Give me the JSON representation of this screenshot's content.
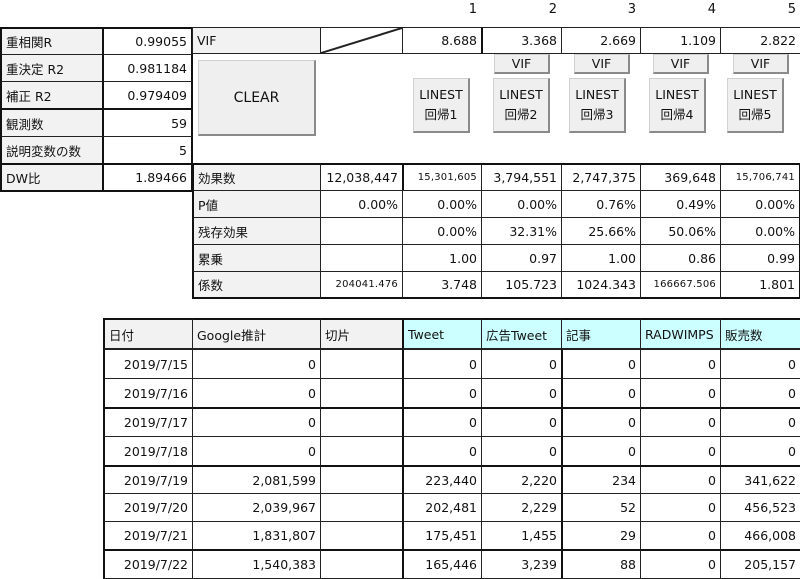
{
  "stats": [
    {
      "label": "重相関R",
      "value": "0.99055"
    },
    {
      "label": "重決定 R2",
      "value": "0.981184"
    },
    {
      "label": "補正 R2",
      "value": "0.979409"
    },
    {
      "label": "観測数",
      "value": "59"
    },
    {
      "label": "説明変数の数",
      "value": "5"
    },
    {
      "label": "DW比",
      "value": "1.89466"
    }
  ],
  "column_numbers": [
    "1",
    "2",
    "3",
    "4",
    "5"
  ],
  "vif_row": {
    "label": "VIF",
    "values": [
      "8.688",
      "3.368",
      "2.669",
      "1.109",
      "2.822"
    ]
  },
  "buttons": {
    "clear": "CLEAR",
    "vif": [
      "VIF",
      "VIF",
      "VIF",
      "VIF"
    ],
    "linest": [
      {
        "line1": "LINEST",
        "line2": "回帰1"
      },
      {
        "line1": "LINEST",
        "line2": "回帰2"
      },
      {
        "line1": "LINEST",
        "line2": "回帰3"
      },
      {
        "line1": "LINEST",
        "line2": "回帰4"
      },
      {
        "line1": "LINEST",
        "line2": "回帰5"
      }
    ]
  },
  "effects": [
    {
      "label": "効果数",
      "values": [
        "12,038,447",
        "15,301,605",
        "3,794,551",
        "2,747,375",
        "369,648",
        "15,706,741"
      ]
    },
    {
      "label": "P値",
      "values": [
        "0.00%",
        "0.00%",
        "0.00%",
        "0.76%",
        "0.49%",
        "0.00%"
      ]
    },
    {
      "label": "残存効果",
      "values": [
        "",
        "0.00%",
        "32.31%",
        "25.66%",
        "50.06%",
        "0.00%"
      ]
    },
    {
      "label": "累乗",
      "values": [
        "",
        "1.00",
        "0.97",
        "1.00",
        "0.86",
        "0.99"
      ]
    },
    {
      "label": "係数",
      "values": [
        "204041.476",
        "3.748",
        "105.723",
        "1024.343",
        "166667.506",
        "1.801"
      ]
    }
  ],
  "data_table": {
    "headers": [
      "日付",
      "Google推計",
      "切片",
      "Tweet",
      "広告Tweet",
      "記事",
      "RADWIMPS",
      "販売数"
    ],
    "rows": [
      [
        "2019/7/15",
        "0",
        "",
        "0",
        "0",
        "0",
        "0",
        "0"
      ],
      [
        "2019/7/16",
        "0",
        "",
        "0",
        "0",
        "0",
        "0",
        "0"
      ],
      [
        "2019/7/17",
        "0",
        "",
        "0",
        "0",
        "0",
        "0",
        "0"
      ],
      [
        "2019/7/18",
        "0",
        "",
        "0",
        "0",
        "0",
        "0",
        "0"
      ],
      [
        "2019/7/19",
        "2,081,599",
        "",
        "223,440",
        "2,220",
        "234",
        "0",
        "341,622"
      ],
      [
        "2019/7/20",
        "2,039,967",
        "",
        "202,481",
        "2,229",
        "52",
        "0",
        "456,523"
      ],
      [
        "2019/7/21",
        "1,831,807",
        "",
        "175,451",
        "1,455",
        "29",
        "0",
        "466,008"
      ],
      [
        "2019/7/22",
        "1,540,383",
        "",
        "165,446",
        "3,239",
        "88",
        "0",
        "205,157"
      ]
    ]
  },
  "colors": {
    "header_cyan": "#ccffff",
    "label_gray": "#f2f2f2"
  }
}
